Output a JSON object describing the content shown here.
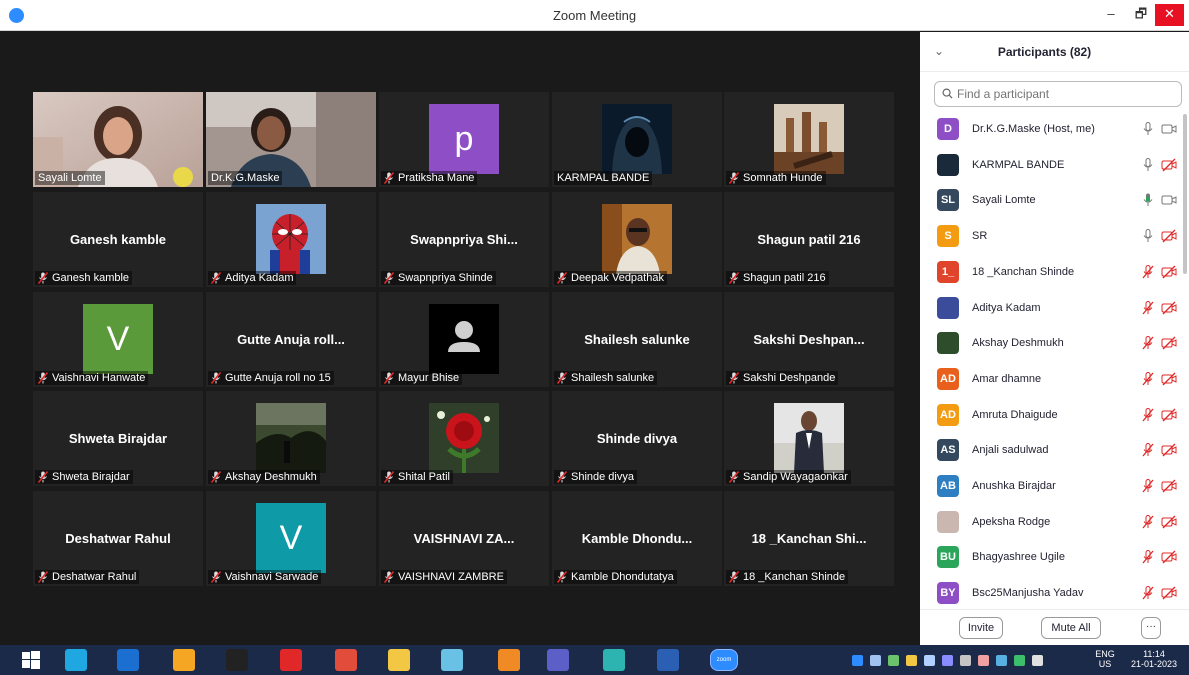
{
  "window": {
    "title": "Zoom Meeting",
    "minimize": "–",
    "maximize": "🗗",
    "close": "✕"
  },
  "colors": {
    "accent": "#2d8cff",
    "muted_red": "#e02828",
    "active_speaker": "#e9e44f",
    "taskbar": "#1c2a4a"
  },
  "gallery": {
    "tiles": [
      {
        "name": "Sayali Lomte",
        "center": "",
        "kind": "video-girl",
        "muted": false,
        "active": true
      },
      {
        "name": "Dr.K.G.Maske",
        "center": "",
        "kind": "video-woman",
        "muted": false
      },
      {
        "name": "Pratiksha Mane",
        "center": "",
        "kind": "letter",
        "letter": "p",
        "bg": "#8e4fc6",
        "muted": true
      },
      {
        "name": "KARMPAL BANDE",
        "center": "",
        "kind": "img-hood",
        "muted": false
      },
      {
        "name": "Somnath Hunde",
        "center": "",
        "kind": "img-chess",
        "muted": true
      },
      {
        "name": "Ganesh kamble",
        "center": "Ganesh kamble",
        "kind": "text",
        "muted": true
      },
      {
        "name": "Aditya Kadam",
        "center": "",
        "kind": "img-spider",
        "muted": true
      },
      {
        "name": "Swapnpriya Shinde",
        "center": "Swapnpriya  Shi...",
        "kind": "text",
        "muted": true
      },
      {
        "name": "Deepak Vedpathak",
        "center": "",
        "kind": "img-man",
        "muted": true
      },
      {
        "name": "Shagun patil 216",
        "center": "Shagun patil 216",
        "kind": "text",
        "muted": true
      },
      {
        "name": "Vaishnavi Hanwate",
        "center": "",
        "kind": "letter",
        "letter": "V",
        "bg": "#5b9a3a",
        "muted": true
      },
      {
        "name": "Gutte Anuja roll no 15",
        "center": "Gutte Anuja roll...",
        "kind": "text",
        "muted": true
      },
      {
        "name": "Mayur Bhise",
        "center": "",
        "kind": "img-person",
        "muted": true
      },
      {
        "name": "Shailesh salunke",
        "center": "Shailesh salunke",
        "kind": "text",
        "muted": true
      },
      {
        "name": "Sakshi  Deshpande",
        "center": "Sakshi  Deshpan...",
        "kind": "text",
        "muted": true
      },
      {
        "name": "Shweta Birajdar",
        "center": "Shweta Birajdar",
        "kind": "text",
        "muted": true
      },
      {
        "name": "Akshay Deshmukh",
        "center": "",
        "kind": "img-dark",
        "muted": true
      },
      {
        "name": "Shital Patil",
        "center": "",
        "kind": "img-rose",
        "muted": true
      },
      {
        "name": "Shinde divya",
        "center": "Shinde divya",
        "kind": "text",
        "muted": true
      },
      {
        "name": "Sandip Wayagaonkar",
        "center": "",
        "kind": "img-suit",
        "muted": true
      },
      {
        "name": "Deshatwar Rahul",
        "center": "Deshatwar Rahul",
        "kind": "text",
        "muted": true
      },
      {
        "name": "Vaishnavi Sarwade",
        "center": "",
        "kind": "letter",
        "letter": "V",
        "bg": "#0e9aa7",
        "muted": true
      },
      {
        "name": "VAISHNAVI ZAMBRE",
        "center": "VAISHNAVI  ZA...",
        "kind": "text",
        "muted": true
      },
      {
        "name": "Kamble Dhondutatya",
        "center": "Kamble  Dhondu...",
        "kind": "text",
        "muted": true
      },
      {
        "name": "18 _Kanchan Shinde",
        "center": "18 _Kanchan Shi...",
        "kind": "text",
        "muted": true
      }
    ]
  },
  "participants": {
    "title": "Participants (82)",
    "search_placeholder": "Find a participant",
    "items": [
      {
        "initials": "D",
        "bg": "#8e4fc6",
        "name": "Dr.K.G.Maske (Host, me)",
        "mic": "on",
        "cam": "on"
      },
      {
        "initials": "",
        "bg": "#1b2a3a",
        "name": "KARMPAL BANDE",
        "mic": "on",
        "cam": "off"
      },
      {
        "initials": "SL",
        "bg": "#34495e",
        "name": "Sayali Lomte",
        "mic": "speaking",
        "cam": "on"
      },
      {
        "initials": "S",
        "bg": "#f39c12",
        "name": "SR",
        "mic": "on",
        "cam": "off"
      },
      {
        "initials": "1_",
        "bg": "#e0442b",
        "name": "18 _Kanchan Shinde",
        "mic": "muted",
        "cam": "off"
      },
      {
        "initials": "",
        "bg": "#3b4c9b",
        "name": "Aditya Kadam",
        "mic": "muted",
        "cam": "off"
      },
      {
        "initials": "",
        "bg": "#2e4d2a",
        "name": "Akshay Deshmukh",
        "mic": "muted",
        "cam": "off"
      },
      {
        "initials": "AD",
        "bg": "#e8601c",
        "name": "Amar dhamne",
        "mic": "muted",
        "cam": "off"
      },
      {
        "initials": "AD",
        "bg": "#f39c12",
        "name": "Amruta Dhaigude",
        "mic": "muted",
        "cam": "off"
      },
      {
        "initials": "AS",
        "bg": "#34495e",
        "name": "Anjali sadulwad",
        "mic": "muted",
        "cam": "off"
      },
      {
        "initials": "AB",
        "bg": "#2d7fc1",
        "name": "Anushka Birajdar",
        "mic": "muted",
        "cam": "off"
      },
      {
        "initials": "",
        "bg": "#c9b7b0",
        "name": "Apeksha Rodge",
        "mic": "muted",
        "cam": "off"
      },
      {
        "initials": "BU",
        "bg": "#2aa55a",
        "name": "Bhagyashree Ugile",
        "mic": "muted",
        "cam": "off"
      },
      {
        "initials": "BY",
        "bg": "#8e4fc6",
        "name": "Bsc25Manjusha Yadav",
        "mic": "muted",
        "cam": "off"
      }
    ],
    "invite_label": "Invite",
    "mute_all_label": "Mute All",
    "more_label": "···"
  },
  "taskbar": {
    "language": "ENG",
    "region": "US",
    "time": "11:14",
    "date": "21-01-2023",
    "apps": [
      "start-icon",
      "ie-icon",
      "hp-icon",
      "photos-icon",
      "camera-icon",
      "acrobat-icon",
      "chrome-icon",
      "explorer-icon",
      "paint-icon",
      "chrome2-icon",
      "teams-icon",
      "edge-icon",
      "word-icon",
      "zoom-icon"
    ],
    "zoom_app_label": "zoom"
  }
}
